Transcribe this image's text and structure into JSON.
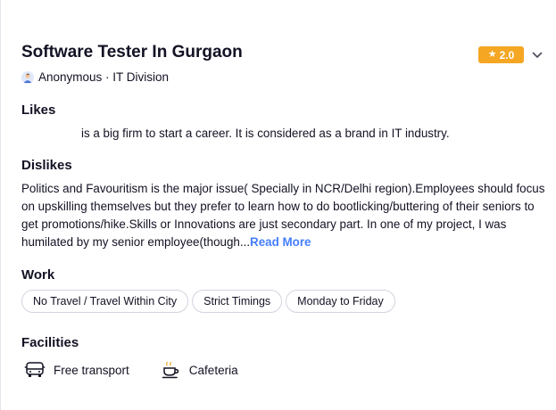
{
  "review": {
    "title": "Software Tester In Gurgaon",
    "rating": "2.0",
    "rating_color": "#f5a623",
    "author": "Anonymous · IT Division"
  },
  "likes": {
    "heading": "Likes",
    "text": "is a big firm to start a career. It is considered as a brand in IT industry."
  },
  "dislikes": {
    "heading": "Dislikes",
    "text": "Politics and Favouritism is the major issue( Specially in NCR/Delhi region).Employees should focus on upskilling themselves but they prefer to learn how to do bootlicking/buttering of their seniors to get promotions/hike.Skills or Innovations are just secondary part. In one of my project, I was humilated by my senior employee(though...",
    "read_more": "Read More",
    "link_color": "#457eff"
  },
  "work": {
    "heading": "Work",
    "tags": [
      "No Travel / Travel Within City",
      "Strict Timings",
      "Monday to Friday"
    ]
  },
  "facilities": {
    "heading": "Facilities",
    "items": [
      {
        "label": "Free transport",
        "icon": "bus-icon"
      },
      {
        "label": "Cafeteria",
        "icon": "coffee-cup-icon"
      }
    ]
  },
  "icons": {
    "rating": "star-icon",
    "expand": "chevron-down-icon",
    "author": "avatar-icon"
  }
}
